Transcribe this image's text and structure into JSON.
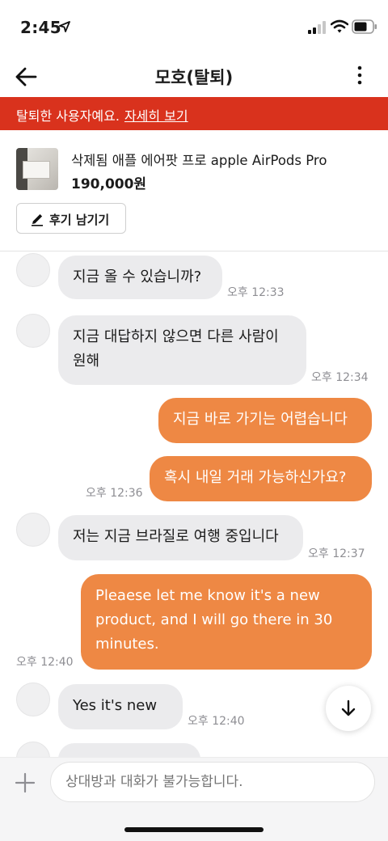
{
  "status_bar": {
    "time": "2:45",
    "icons": [
      "location-arrow-icon",
      "signal-icon",
      "wifi-icon",
      "battery-icon"
    ]
  },
  "header": {
    "title": "모호(탈퇴)",
    "back_icon": "back-arrow-icon",
    "more_icon": "more-vertical-icon"
  },
  "banner": {
    "text": "탈퇴한 사용자예요.",
    "link": "자세히 보기",
    "color": "#d9321d"
  },
  "product": {
    "title": "삭제됨 애플 에어팟 프로 apple AirPods Pro",
    "price": "190,000원",
    "review_button": "후기 남기기"
  },
  "messages": [
    {
      "from": "other",
      "lines": [
        "지금 올 수 있습니까?"
      ],
      "time": "오후 12:33"
    },
    {
      "from": "other",
      "lines": [
        "지금 대답하지 않으면 다른 사람이",
        "원해"
      ],
      "time": "오후 12:34"
    },
    {
      "from": "me",
      "lines": [
        "지금 바로 가기는 어렵습니다"
      ],
      "time": ""
    },
    {
      "from": "me",
      "lines": [
        "혹시 내일 거래 가능하신가요?"
      ],
      "time": "오후 12:36"
    },
    {
      "from": "other",
      "lines": [
        "저는 지금 브라질로 여행 중입니다"
      ],
      "time": "오후 12:37"
    },
    {
      "from": "me",
      "lines": [
        "Pleaese let me know it's a new",
        "product, and I will go there in 30",
        "minutes."
      ],
      "time": "오후 12:40"
    },
    {
      "from": "other",
      "lines": [
        "Yes it's new"
      ],
      "time": "오후 12:40"
    }
  ],
  "input": {
    "placeholder": "상대방과 대화가 불가능합니다."
  },
  "colors": {
    "accent": "#ee8844",
    "incoming_bubble": "#ebebed",
    "timestamp": "#8e8e93"
  }
}
